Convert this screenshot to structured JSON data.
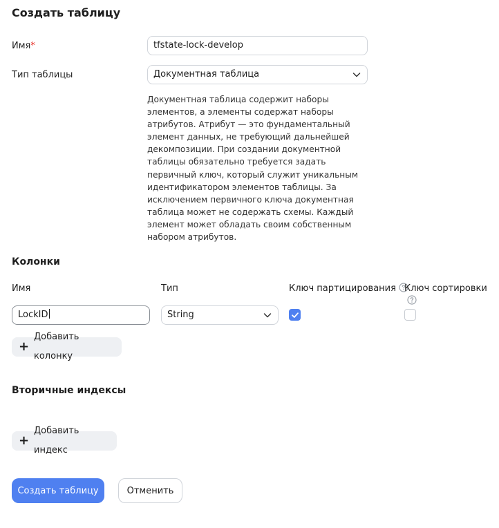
{
  "page": {
    "title": "Создать таблицу"
  },
  "form": {
    "name_label": "Имя",
    "name_required_mark": "*",
    "name_value": "tfstate-lock-develop",
    "type_label": "Тип таблицы",
    "type_value": "Документная таблица",
    "type_description": "Документная таблица содержит наборы элементов, а элементы содержат наборы атрибутов. Атрибут — это фундаментальный элемент данных, не требующий дальнейшей декомпозиции. При создании документной таблицы обязательно требуется задать первичный ключ, который служит уникальным идентификатором элементов таблицы. За исключением первичного ключа документная таблица может не содержать схемы. Каждый элемент может обладать своим собственным набором атрибутов."
  },
  "columns": {
    "title": "Колонки",
    "headers": {
      "name": "Имя",
      "type": "Тип",
      "partition_key": "Ключ партицирования",
      "sort_key": "Ключ сортировки"
    },
    "rows": [
      {
        "name": "LockID",
        "type": "String",
        "partition_key": true,
        "sort_key": false
      }
    ],
    "add_button": "Добавить колонку"
  },
  "secondary_indexes": {
    "title": "Вторичные индексы",
    "add_button": "Добавить индекс"
  },
  "actions": {
    "create": "Создать таблицу",
    "cancel": "Отменить"
  },
  "colors": {
    "accent": "#4f80f0",
    "required": "#e8322a"
  },
  "icons": {
    "dropdown": "chevron-down-icon",
    "help": "question-circle-icon",
    "add": "plus-icon",
    "check": "checkmark-icon"
  }
}
